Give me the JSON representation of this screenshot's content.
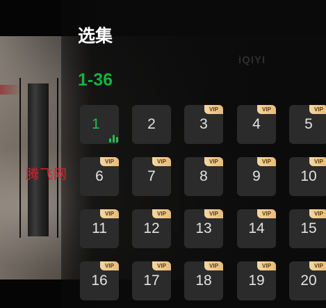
{
  "panel": {
    "title": "选集",
    "range_tab": "1-36"
  },
  "video": {
    "logo_text": "iQIYI",
    "watermark": "腾飞网"
  },
  "colors": {
    "accent_green": "#1fbf4c",
    "vip_gold": "#ecc383",
    "tile_bg": "#2b2b2b",
    "watermark_red": "#d8202a"
  },
  "episodes": [
    {
      "num": "1",
      "vip": "",
      "current": true,
      "icon": "playing-bars-icon"
    },
    {
      "num": "2",
      "vip": ""
    },
    {
      "num": "3",
      "vip": "VIP"
    },
    {
      "num": "4",
      "vip": "VIP"
    },
    {
      "num": "5",
      "vip": "VIP"
    },
    {
      "num": "6",
      "vip": "VIP"
    },
    {
      "num": "7",
      "vip": "VIP"
    },
    {
      "num": "8",
      "vip": "VIP"
    },
    {
      "num": "9",
      "vip": "VIP"
    },
    {
      "num": "10",
      "vip": "VIP"
    },
    {
      "num": "11",
      "vip": "VIP"
    },
    {
      "num": "12",
      "vip": "VIP"
    },
    {
      "num": "13",
      "vip": "VIP"
    },
    {
      "num": "14",
      "vip": "VIP"
    },
    {
      "num": "15",
      "vip": "VIP"
    },
    {
      "num": "16",
      "vip": "VIP"
    },
    {
      "num": "17",
      "vip": "VIP"
    },
    {
      "num": "18",
      "vip": "VIP"
    },
    {
      "num": "19",
      "vip": "VIP"
    },
    {
      "num": "20",
      "vip": "VIP"
    }
  ]
}
